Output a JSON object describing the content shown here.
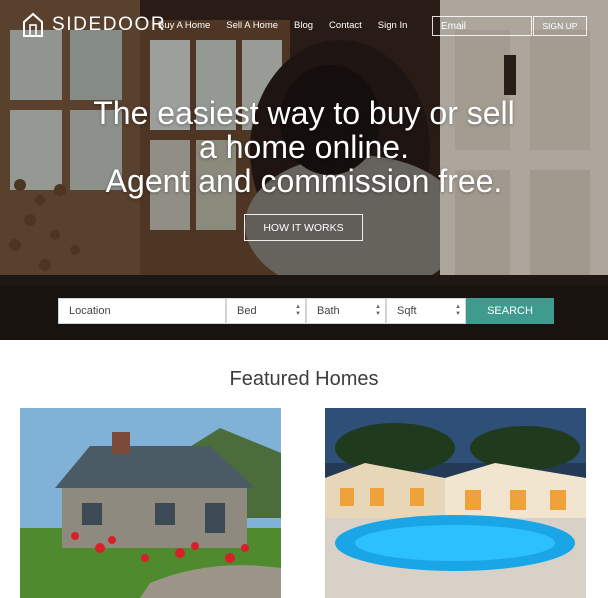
{
  "brand": {
    "name": "SIDEDOOR"
  },
  "nav": {
    "links": [
      "Buy A Home",
      "Sell A Home",
      "Blog",
      "Contact",
      "Sign In"
    ],
    "email_placeholder": "Email",
    "signup_label": "SIGN UP"
  },
  "hero": {
    "headline_lines": [
      "The easiest way to buy or sell",
      "a home online.",
      "Agent and commission free."
    ],
    "cta_label": "HOW IT WORKS"
  },
  "search": {
    "location_placeholder": "Location",
    "bed_label": "Bed",
    "bath_label": "Bath",
    "sqft_label": "Sqft",
    "button_label": "SEARCH"
  },
  "featured": {
    "title": "Featured Homes"
  },
  "colors": {
    "accent": "#3f9b8e",
    "text_dark": "#3d3d3d",
    "white": "#ffffff"
  },
  "icons": {
    "logo": "house-outline-icon",
    "select_arrows": "updown-arrows-icon"
  }
}
